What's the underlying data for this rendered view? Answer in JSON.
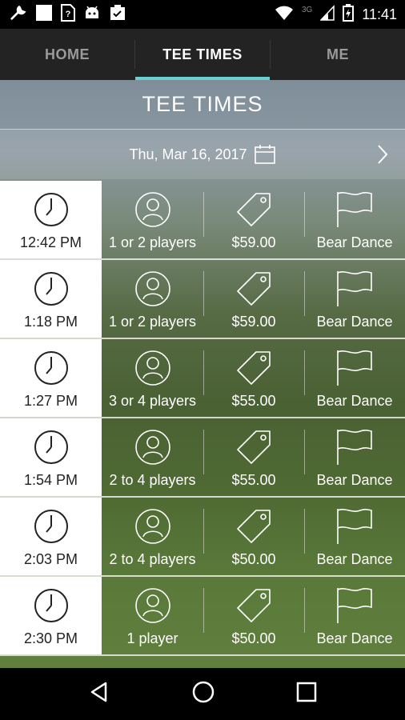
{
  "status_bar": {
    "time": "11:41",
    "network_label": "3G",
    "left_icons": [
      "wrench-icon",
      "square-icon",
      "sim-unknown-icon",
      "android-icon",
      "clipboard-check-icon"
    ],
    "right_icons": [
      "wifi-icon",
      "signal-icon",
      "battery-charging-icon"
    ]
  },
  "tabs": [
    {
      "label": "HOME",
      "active": false
    },
    {
      "label": "TEE TIMES",
      "active": true
    },
    {
      "label": "ME",
      "active": false
    }
  ],
  "accent_color": "#6ad0cf",
  "header": {
    "title": "TEE TIMES"
  },
  "date_bar": {
    "date": "Thu, Mar 16, 2017",
    "calendar_icon": "calendar-icon",
    "next_icon": "chevron-right-icon"
  },
  "tee_times": [
    {
      "time": "12:42 PM",
      "players": "1 or 2 players",
      "price": "$59.00",
      "course": "Bear Dance"
    },
    {
      "time": "1:18 PM",
      "players": "1 or 2 players",
      "price": "$59.00",
      "course": "Bear Dance"
    },
    {
      "time": "1:27 PM",
      "players": "3 or 4 players",
      "price": "$55.00",
      "course": "Bear Dance"
    },
    {
      "time": "1:54 PM",
      "players": "2 to 4 players",
      "price": "$55.00",
      "course": "Bear Dance"
    },
    {
      "time": "2:03 PM",
      "players": "2 to 4 players",
      "price": "$50.00",
      "course": "Bear Dance"
    },
    {
      "time": "2:30 PM",
      "players": "1 player",
      "price": "$50.00",
      "course": "Bear Dance"
    }
  ],
  "nav_bar": {
    "icons": [
      "back-icon",
      "home-icon",
      "recents-icon"
    ]
  }
}
